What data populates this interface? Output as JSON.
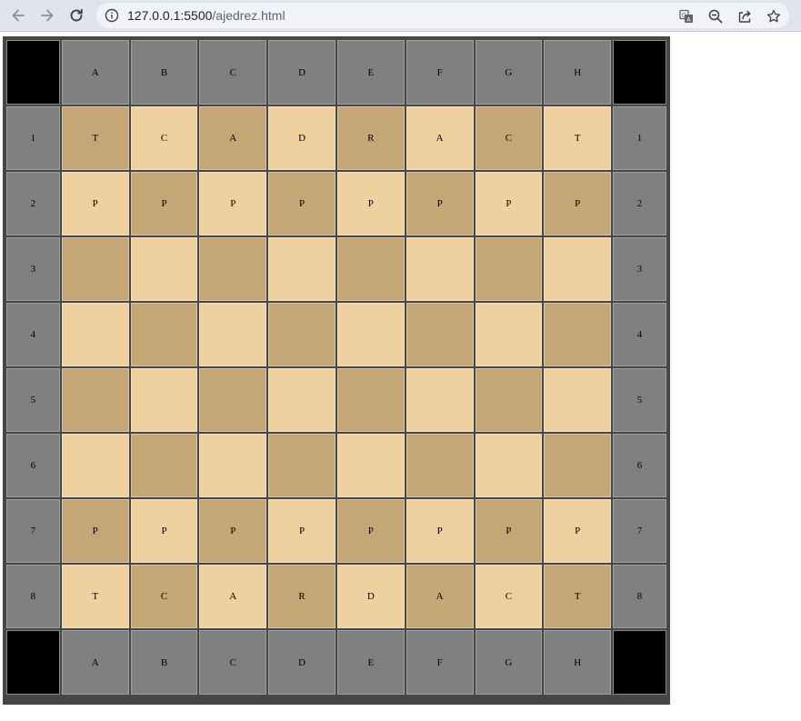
{
  "browser": {
    "url_host": "127.0.0.1:5500",
    "url_path": "/ajedrez.html"
  },
  "board": {
    "columns": [
      "A",
      "B",
      "C",
      "D",
      "E",
      "F",
      "G",
      "H"
    ],
    "rows": [
      {
        "label": "1",
        "pieces": [
          "T",
          "C",
          "A",
          "D",
          "R",
          "A",
          "C",
          "T"
        ]
      },
      {
        "label": "2",
        "pieces": [
          "P",
          "P",
          "P",
          "P",
          "P",
          "P",
          "P",
          "P"
        ]
      },
      {
        "label": "3",
        "pieces": [
          "",
          "",
          "",
          "",
          "",
          "",
          "",
          ""
        ]
      },
      {
        "label": "4",
        "pieces": [
          "",
          "",
          "",
          "",
          "",
          "",
          "",
          ""
        ]
      },
      {
        "label": "5",
        "pieces": [
          "",
          "",
          "",
          "",
          "",
          "",
          "",
          ""
        ]
      },
      {
        "label": "6",
        "pieces": [
          "",
          "",
          "",
          "",
          "",
          "",
          "",
          ""
        ]
      },
      {
        "label": "7",
        "pieces": [
          "P",
          "P",
          "P",
          "P",
          "P",
          "P",
          "P",
          "P"
        ]
      },
      {
        "label": "8",
        "pieces": [
          "T",
          "C",
          "A",
          "R",
          "D",
          "A",
          "C",
          "T"
        ]
      }
    ],
    "colors": {
      "dark_square": "#c4a677",
      "light_square": "#efd19f",
      "label_cell": "#808080",
      "corner_cell": "#000000",
      "border": "#474747"
    }
  },
  "icons": {
    "back": "arrow-left-icon",
    "forward": "arrow-right-icon",
    "reload": "reload-icon",
    "site_info": "info-icon",
    "translate": "translate-icon",
    "zoom": "zoom-out-icon",
    "share": "share-icon",
    "bookmark": "star-icon"
  }
}
